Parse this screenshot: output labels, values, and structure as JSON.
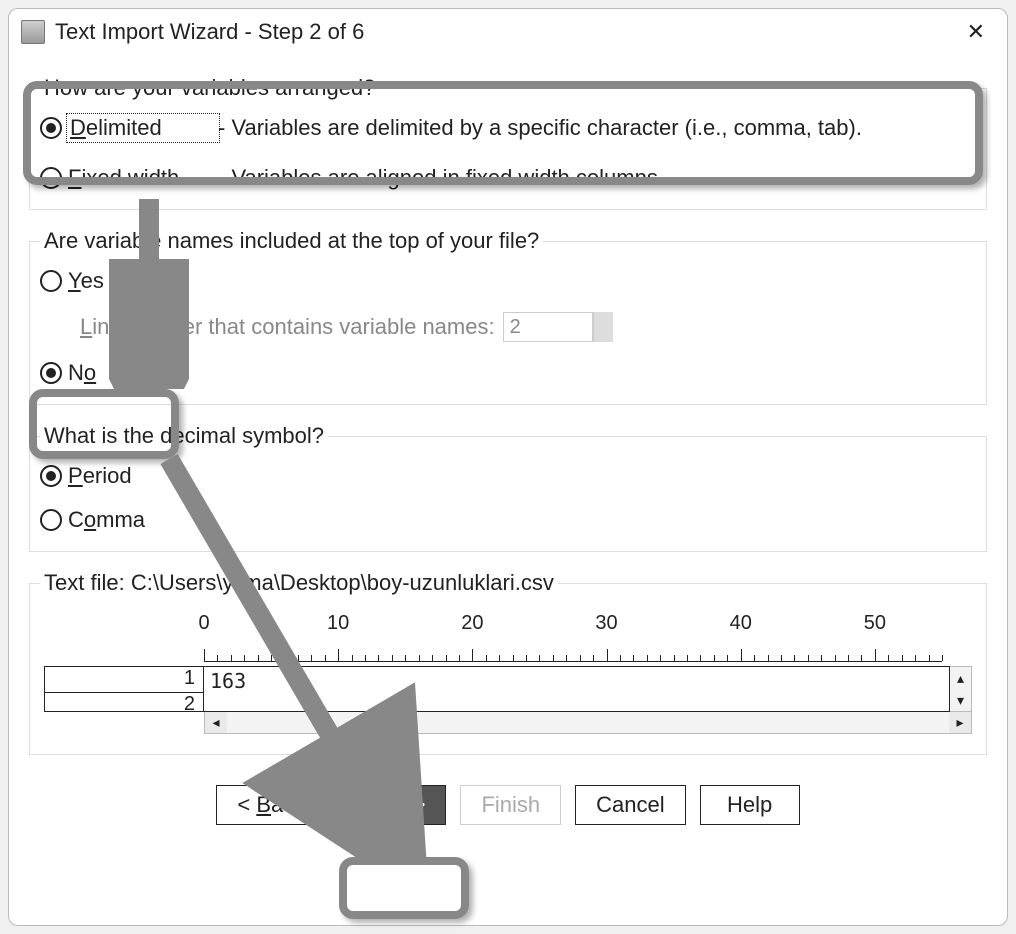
{
  "window": {
    "title": "Text Import Wizard - Step 2 of 6",
    "close_glyph": "✕"
  },
  "group1": {
    "legend": "How are your variables arranged?",
    "delimited": {
      "label_pre": "",
      "label_u": "D",
      "label_post": "elimited",
      "desc": "- Variables are delimited by a specific character (i.e., comma, tab)."
    },
    "fixed": {
      "label_pre": "",
      "label_u": "F",
      "label_post": "ixed width",
      "desc": "- Variables are aligned in fixed width columns."
    }
  },
  "group2": {
    "legend": "Are variable names included at the top of your file?",
    "yes": {
      "label_pre": "",
      "label_u": "Y",
      "label_post": "es"
    },
    "line_label_pre": "",
    "line_label_u": "L",
    "line_label_post": "ine number that contains variable names:",
    "line_value": "2",
    "no": {
      "label_pre": "N",
      "label_u": "o",
      "label_post": ""
    }
  },
  "group3": {
    "legend": "What is the decimal symbol?",
    "period": {
      "label_pre": "",
      "label_u": "P",
      "label_post": "eriod"
    },
    "comma": {
      "label_pre": "C",
      "label_u": "o",
      "label_post": "mma"
    }
  },
  "preview": {
    "legend_pre": "Text file:  ",
    "path": "C:\\Users\\yilma\\Desktop\\boy-uzunluklari.csv",
    "ruler_ticks": [
      "0",
      "10",
      "20",
      "30",
      "40",
      "50"
    ],
    "rows": [
      "1",
      "2"
    ],
    "data_line1": "163"
  },
  "buttons": {
    "back_pre": "<  ",
    "back_u": "B",
    "back_post": "ack",
    "next_pre": "",
    "next_u": "N",
    "next_post": "ext  >",
    "finish": "Finish",
    "cancel": "Cancel",
    "help": "Help"
  }
}
